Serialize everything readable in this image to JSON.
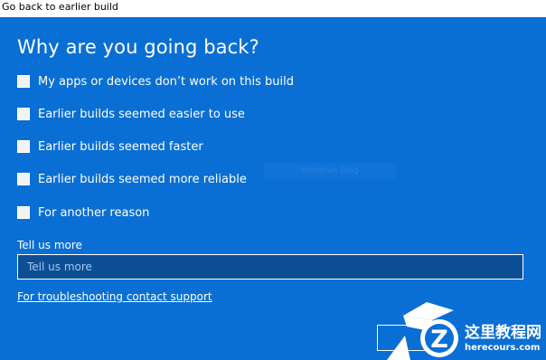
{
  "window": {
    "title": "Go back to earlier build"
  },
  "main": {
    "heading": "Why are you going back?",
    "options": [
      {
        "label": "My apps or devices don’t work on this build",
        "checked": false
      },
      {
        "label": "Earlier builds seemed easier to use",
        "checked": false
      },
      {
        "label": "Earlier builds seemed faster",
        "checked": false
      },
      {
        "label": "Earlier builds seemed more reliable",
        "checked": false
      },
      {
        "label": "For another reason",
        "checked": false
      }
    ],
    "watermark_text": "Windows Blog",
    "tell_us_more": {
      "label": "Tell us more",
      "placeholder": "Tell us more",
      "value": ""
    },
    "support_link": "For troubleshooting contact support"
  },
  "footer": {
    "next_label": ""
  },
  "site_logo": {
    "name": "这里教程网",
    "url": "herecours.com"
  },
  "colors": {
    "panel_background": "#0a6fd4",
    "input_background": "#0c4f96",
    "text": "#ffffff"
  },
  "icons": {
    "logo": "site-logo-icon"
  }
}
